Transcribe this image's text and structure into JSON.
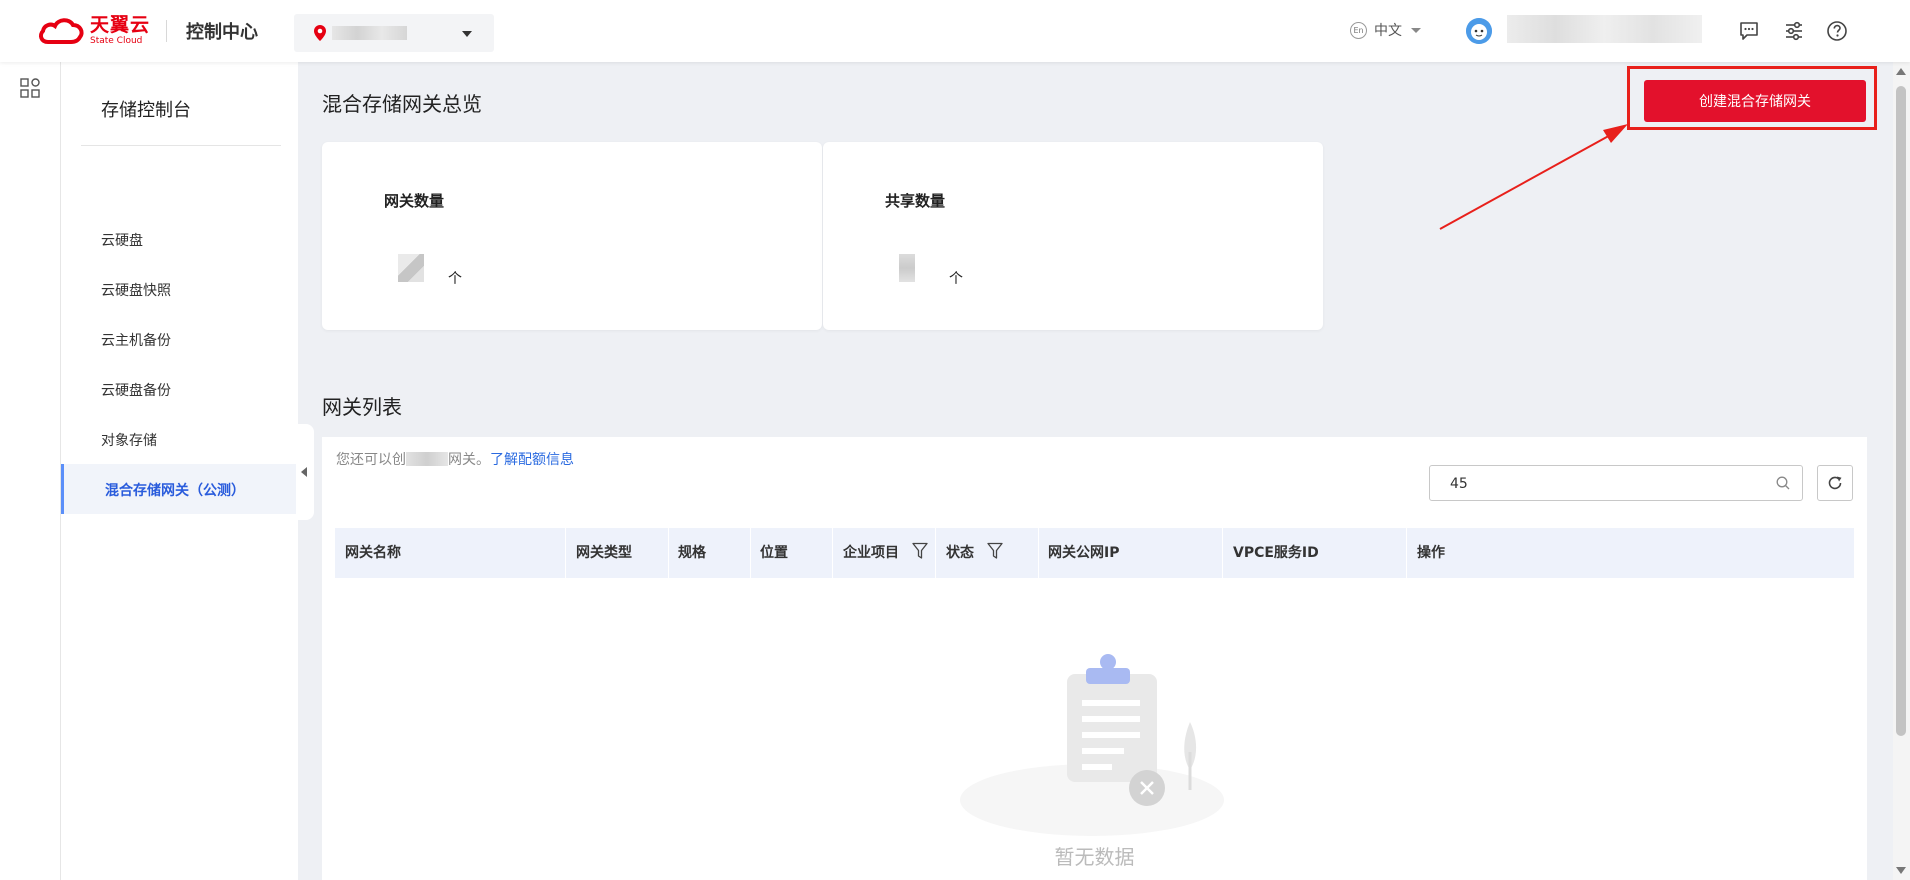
{
  "header": {
    "brand_cn": "天翼云",
    "brand_en": "State Cloud",
    "console_title": "控制中心",
    "language": "中文",
    "language_badge": "En"
  },
  "sidebar": {
    "title": "存储控制台",
    "items": [
      {
        "label": "云硬盘"
      },
      {
        "label": "云硬盘快照"
      },
      {
        "label": "云主机备份"
      },
      {
        "label": "云硬盘备份"
      },
      {
        "label": "对象存储"
      },
      {
        "label": "混合存储网关（公测）",
        "active": true
      }
    ]
  },
  "main": {
    "overview_title": "混合存储网关总览",
    "create_button": "创建混合存储网关",
    "cards": [
      {
        "label": "网关数量",
        "unit": "个"
      },
      {
        "label": "共享数量",
        "unit": "个"
      }
    ],
    "list_title": "网关列表",
    "quota_prefix": "您还可以创",
    "quota_suffix": "网关。",
    "quota_link": "了解配额信息",
    "search_value": "45",
    "columns": [
      "网关名称",
      "网关类型",
      "规格",
      "位置",
      "企业项目",
      "状态",
      "网关公网IP",
      "VPCE服务ID",
      "操作"
    ],
    "empty_text": "暂无数据"
  },
  "colors": {
    "brand_red": "#e60012",
    "button_red": "#e3112c",
    "annotation_red": "#e8201b",
    "active_blue": "#2a5cdc"
  }
}
